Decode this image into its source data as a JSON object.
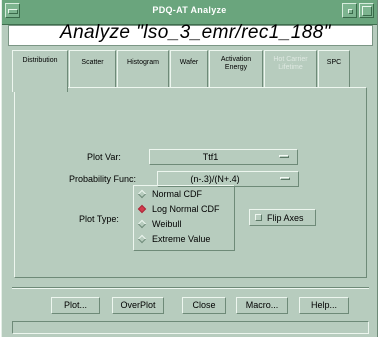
{
  "window": {
    "title": "PDQ-AT Analyze"
  },
  "header": {
    "title": "Analyze \"lso_3_emr/rec1_188\""
  },
  "tabs": [
    {
      "label": "Distribution",
      "active": true,
      "enabled": true
    },
    {
      "label": "Scatter",
      "active": false,
      "enabled": true
    },
    {
      "label": "Histogram",
      "active": false,
      "enabled": true
    },
    {
      "label": "Wafer",
      "active": false,
      "enabled": true
    },
    {
      "label": "Activation Energy",
      "active": false,
      "enabled": true
    },
    {
      "label": "Hot Carrier Lifetime",
      "active": false,
      "enabled": false
    },
    {
      "label": "SPC",
      "active": false,
      "enabled": true
    }
  ],
  "form": {
    "plot_var": {
      "label": "Plot Var:",
      "value": "Ttf1"
    },
    "probability_func": {
      "label": "Probability Func:",
      "value": "(n-.3)/(N+.4)"
    },
    "plot_type": {
      "label": "Plot Type:",
      "options": [
        "Normal CDF",
        "Log Normal CDF",
        "Weibull",
        "Extreme Value"
      ],
      "selected": "Log Normal CDF"
    },
    "flip_axes": {
      "label": "Flip Axes",
      "checked": false
    }
  },
  "buttons": {
    "plot": "Plot...",
    "overplot": "OverPlot",
    "close": "Close",
    "macro": "Macro...",
    "help": "Help..."
  },
  "colors": {
    "background": "#b7ccbe",
    "titlebar": "#6aa57d",
    "radio_selected": "#d23b4c"
  }
}
